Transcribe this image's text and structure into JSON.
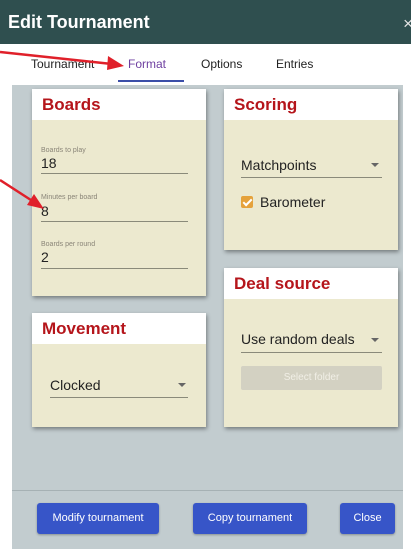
{
  "window": {
    "title": "Edit Tournament",
    "close_glyph": "×"
  },
  "tabs": [
    {
      "label": "Tournament"
    },
    {
      "label": "Format"
    },
    {
      "label": "Options"
    },
    {
      "label": "Entries"
    }
  ],
  "boards_card": {
    "title": "Boards",
    "fields": [
      {
        "label": "Boards to play",
        "value": "18"
      },
      {
        "label": "Minutes per board",
        "value": "8"
      },
      {
        "label": "Boards per round",
        "value": "2"
      }
    ]
  },
  "scoring_card": {
    "title": "Scoring",
    "method_value": "Matchpoints",
    "barometer_label": "Barometer",
    "barometer_checked": true
  },
  "movement_card": {
    "title": "Movement",
    "movement_value": "Clocked"
  },
  "deal_source_card": {
    "title": "Deal source",
    "source_value": "Use random deals",
    "select_folder_label": "Select folder"
  },
  "footer": {
    "modify_label": "Modify tournament",
    "copy_label": "Copy tournament",
    "close_label": "Close"
  },
  "colors": {
    "title_bar": "#2f4f4f",
    "active_tab_text": "#6e3fa0",
    "card_title": "#b5151b",
    "card_body": "#ece9cf",
    "button": "#3755c8",
    "annotation_arrow": "#e0202a"
  }
}
